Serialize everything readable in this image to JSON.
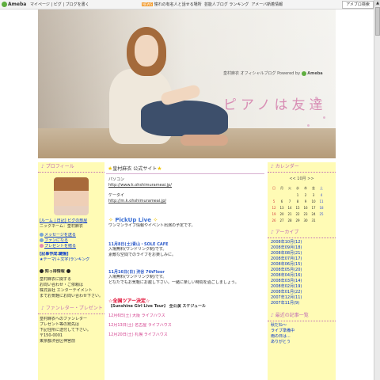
{
  "topbar": {
    "logo": "Ameba",
    "nav": "マイページ | ピグ | ブログを書く",
    "news_badge": "NEWS",
    "news": "憧れの有名人と話せる場所",
    "news2": "芸能人ブログ ランキング",
    "news3": "アメーバ新着情報",
    "right_button": "アメブロ検索"
  },
  "header": {
    "subtitle": "皇村麻衣 オフィシャルブログ Powered by",
    "brand": "Ameba",
    "title": "ピアノは友達"
  },
  "left": {
    "profile_head": "プロフィール",
    "profile_name_link": "[ルーム | 日記] ピグの部屋",
    "nickname": "ニックネーム：皇村麻衣",
    "message": "メッセージを送る",
    "fan": "ファンになる",
    "present": "プレゼントを贈る",
    "ranking_head": "[記事作成:鍵盤]",
    "ranking_sub": "★テーマ(＋文字)ランキング",
    "favorite_head": "知っ得情報",
    "favorite_lines": [
      "皇村麻衣に関する",
      "お問い合わせ・ご依頼は",
      "株式会社 エンターテイメント",
      "までお気軽にお問い合わせ下さい。"
    ],
    "letter_head": "ファンレター・プレゼント",
    "letter_lines": [
      "皇村麻衣へのファンレター",
      "プレゼント等の宛先は",
      "下記住所に送付して下さい。",
      "〒150-0001",
      "東京都渋谷区神宮前"
    ]
  },
  "main": {
    "title": "皇村麻衣 公式サイト",
    "pc_label": "パソコン",
    "pc_url": "http://www.k.ohshimurameai.jp/",
    "mobile_label": "ケータイ",
    "mobile_url": "http://m.k.ohshimurameai.jp/",
    "pickup": "PickUp Live",
    "pickup_sub": "ワンマンライブ情報やイベント出演の予定です。",
    "ev1_title": "11月8日(土)青山・SOLE CAFE",
    "ev1_lines": [
      "入場無料(ワンドリンク制)です。",
      "素敵な空間でのライブをお楽しみに。"
    ],
    "ev2_title": "11月16日(日) 渋谷 7thFloor",
    "ev2_lines": [
      "入場無料(ワンドリンク制)です。",
      "どなたでもお気軽にお越し下さい。一緒に楽しい時間を過ごしましょう。"
    ],
    "tour_title": "☆全国ツアー決定☆",
    "tour_sub": "【Sunshine Girl Live Tour】 全公演 スケジュール",
    "tour_items": [
      "12月6日(土) 大阪 ライブハウス",
      "12月13日(土) 名古屋 ライブハウス",
      "12月20日(土) 札幌 ライブハウス"
    ]
  },
  "right": {
    "calendar_head": "カレンダー",
    "calendar_month": "<< 10月 >>",
    "weekdays": [
      "日",
      "月",
      "火",
      "水",
      "木",
      "金",
      "土"
    ],
    "calendar_rows": [
      [
        "",
        "",
        "",
        "1",
        "2",
        "3",
        "4"
      ],
      [
        "5",
        "6",
        "7",
        "8",
        "9",
        "10",
        "11"
      ],
      [
        "12",
        "13",
        "14",
        "15",
        "16",
        "17",
        "18"
      ],
      [
        "19",
        "20",
        "21",
        "22",
        "23",
        "24",
        "25"
      ],
      [
        "26",
        "27",
        "28",
        "29",
        "30",
        "31",
        ""
      ]
    ],
    "archive_head": "アーカイブ",
    "archive_items": [
      "2008年10月(12)",
      "2008年09月(18)",
      "2008年08月(21)",
      "2008年07月(17)",
      "2008年06月(15)",
      "2008年05月(20)",
      "2008年04月(16)",
      "2008年03月(14)",
      "2008年02月(19)",
      "2008年01月(22)",
      "2007年12月(11)",
      "2007年11月(9)"
    ],
    "recent_head": "最近の記事一覧",
    "recent_items": [
      "秋だね～",
      "ライブ準備中",
      "雨の日は...",
      "ありがとう"
    ]
  }
}
